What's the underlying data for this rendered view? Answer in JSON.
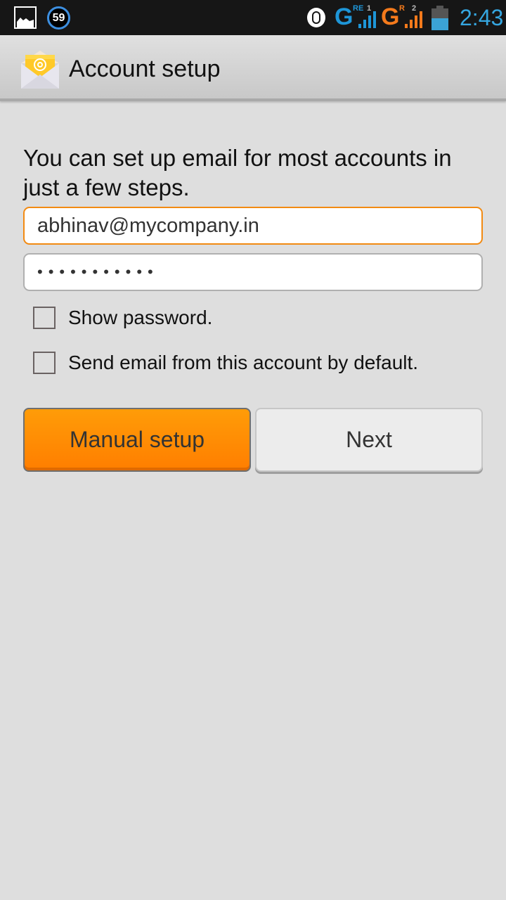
{
  "status_bar": {
    "notification_badge": "59",
    "sim1": {
      "network": "G",
      "tags": "RE",
      "slot": "1",
      "color": "#1e96d8"
    },
    "sim2": {
      "network": "G",
      "tags": "R",
      "slot": "2",
      "color": "#f47a1c"
    },
    "battery_level": 0.55,
    "time": "2:43"
  },
  "action_bar": {
    "title": "Account setup",
    "icon": "email-envelope-icon"
  },
  "form": {
    "intro": "You can set up email for most accounts in just a few steps.",
    "email_value": "abhinav@mycompany.in",
    "password_value": "•••••••••••",
    "show_password_label": "Show password.",
    "show_password_checked": false,
    "default_account_label": "Send email from this account by default.",
    "default_account_checked": false
  },
  "buttons": {
    "manual_setup": "Manual setup",
    "next": "Next"
  },
  "colors": {
    "accent_orange": "#ff8c00",
    "focus_border": "#f28a12",
    "clock_blue": "#35a6e0"
  }
}
